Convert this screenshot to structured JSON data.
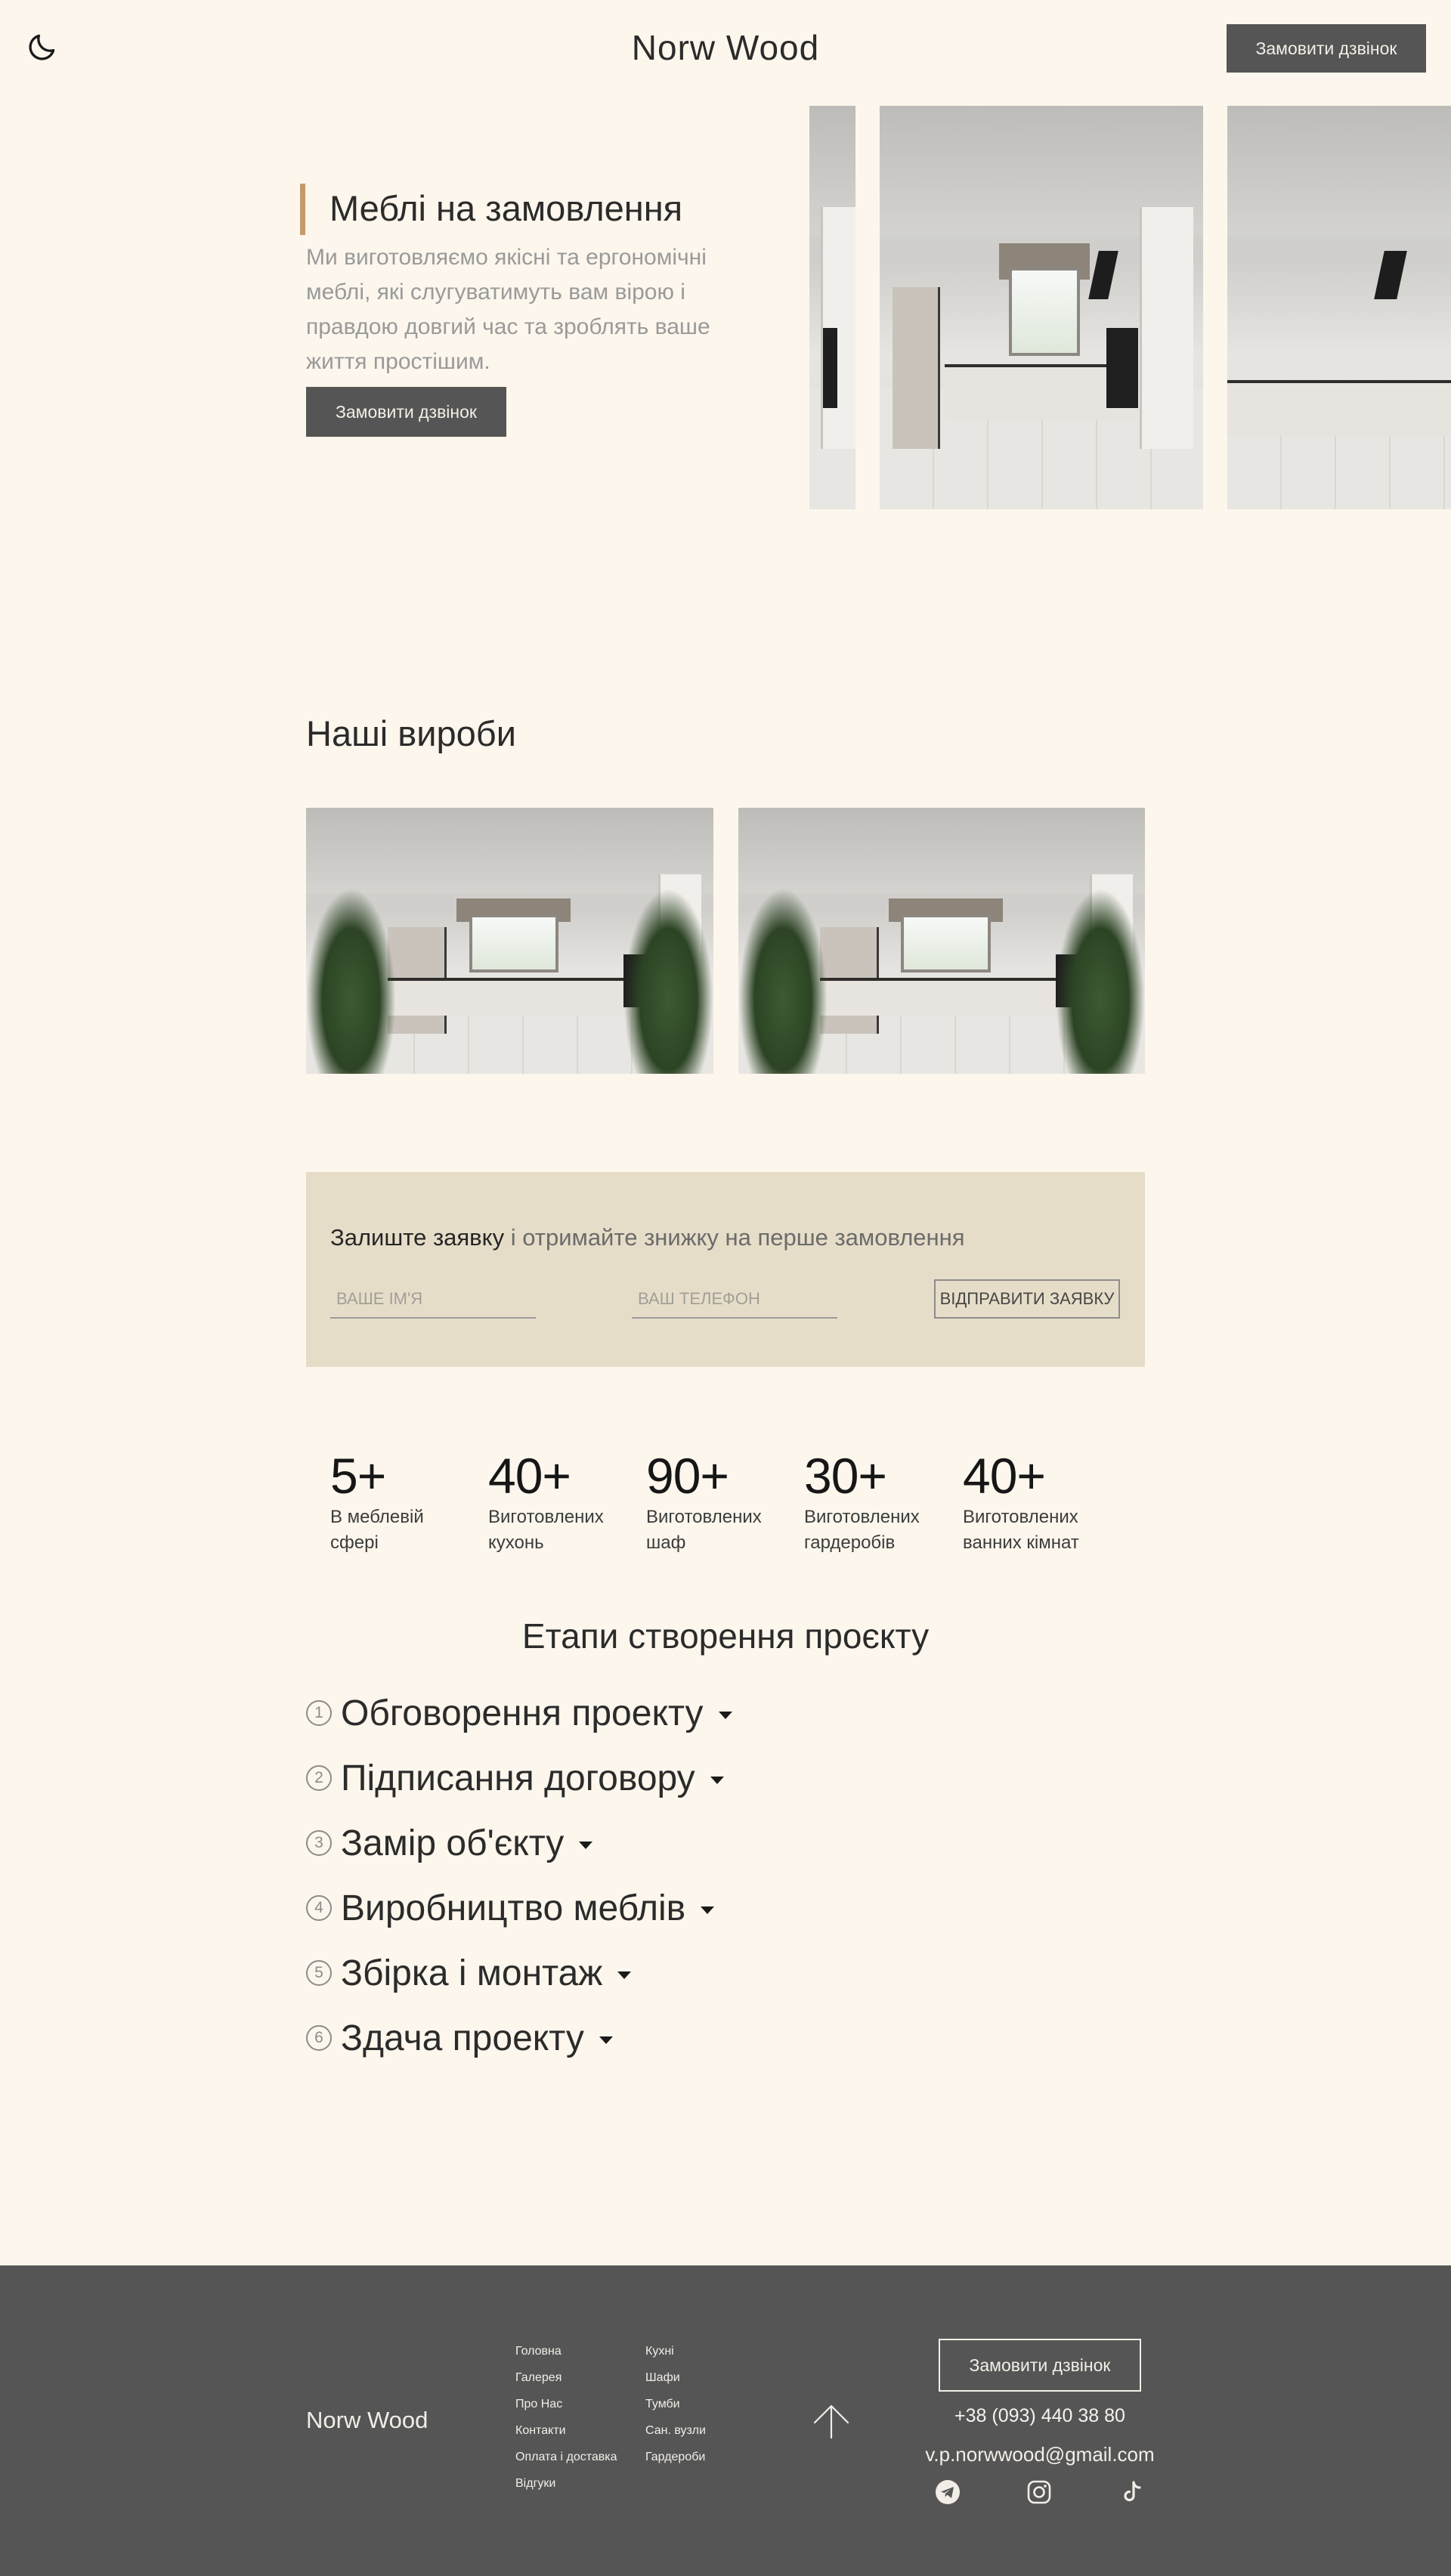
{
  "header": {
    "theme_icon": "moon-icon",
    "brand": "Norw Wood",
    "cta": "Замовити дзвінок"
  },
  "hero": {
    "title": "Меблі на замовлення",
    "text": "Ми виготовляємо якісні та ергономічні меблі, які слугуватимуть вам вірою і правдою довгий час та зроблять ваше життя простішим.",
    "cta": "Замовити дзвінок"
  },
  "products": {
    "title": "Наші вироби"
  },
  "lead_form": {
    "heading_strong": "Залиште заявку",
    "heading_rest": " і отримайте знижку на перше замовлення",
    "name_placeholder": "ВАШЕ ІМ'Я",
    "phone_placeholder": "ВАШ ТЕЛЕФОН",
    "submit": "ВІДПРАВИТИ ЗАЯВКУ"
  },
  "stats": [
    {
      "number": "5+",
      "label_line1": "В меблевій",
      "label_line2": "сфері"
    },
    {
      "number": "40+",
      "label_line1": "Виготовлених",
      "label_line2": "кухонь"
    },
    {
      "number": "90+",
      "label_line1": "Виготовлених",
      "label_line2": "шаф"
    },
    {
      "number": "30+",
      "label_line1": "Виготовлених",
      "label_line2": "гардеробів"
    },
    {
      "number": "40+",
      "label_line1": "Виготовлених",
      "label_line2": "ванних кімнат"
    }
  ],
  "stages": {
    "title": "Етапи створення проєкту",
    "items": [
      {
        "num": "1",
        "label": "Обговорення проекту"
      },
      {
        "num": "2",
        "label": "Підписання договору"
      },
      {
        "num": "3",
        "label": "Замір об'єкту"
      },
      {
        "num": "4",
        "label": "Виробництво меблів"
      },
      {
        "num": "5",
        "label": "Збірка і монтаж"
      },
      {
        "num": "6",
        "label": "Здача проекту"
      }
    ]
  },
  "footer": {
    "brand": "Norw Wood",
    "nav_col1": [
      "Головна",
      "Галерея",
      "Про Нас",
      "Контакти",
      "Оплата і доставка",
      "Відгуки"
    ],
    "nav_col2": [
      "Кухні",
      "Шафи",
      "Тумби",
      "Сан. вузли",
      "Гардероби"
    ],
    "cta": "Замовити дзвінок",
    "phone": "+38 (093) 440 38 80",
    "email": "v.p.norwwood@gmail.com",
    "socials": [
      "telegram-icon",
      "instagram-icon",
      "tiktok-icon"
    ]
  },
  "colors": {
    "background": "#fcf6ec",
    "button_dark": "#555555",
    "accent_bar": "#c49a6c",
    "form_bg": "#e6ddc8",
    "footer_bg": "#555555"
  }
}
